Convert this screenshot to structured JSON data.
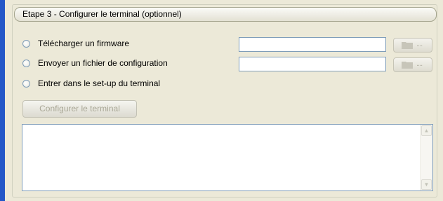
{
  "section": {
    "title": "Etape 3 - Configurer le terminal (optionnel)"
  },
  "options": [
    {
      "label": "Télécharger un firmware"
    },
    {
      "label": "Envoyer un fichier de configuration"
    },
    {
      "label": "Entrer dans le set-up du terminal"
    }
  ],
  "firmware_field": {
    "value": ""
  },
  "config_field": {
    "value": ""
  },
  "browse_label": "....",
  "config_button": {
    "label": "Configurer le terminal",
    "enabled": false
  },
  "log": {
    "text": ""
  },
  "colors": {
    "accent_bar": "#2457c8",
    "window_bg": "#ece9d8",
    "disabled_text": "#a9a796"
  },
  "icons": {
    "browse": "folder-icon",
    "scroll_up": "arrow-up-icon",
    "scroll_down": "arrow-down-icon"
  }
}
